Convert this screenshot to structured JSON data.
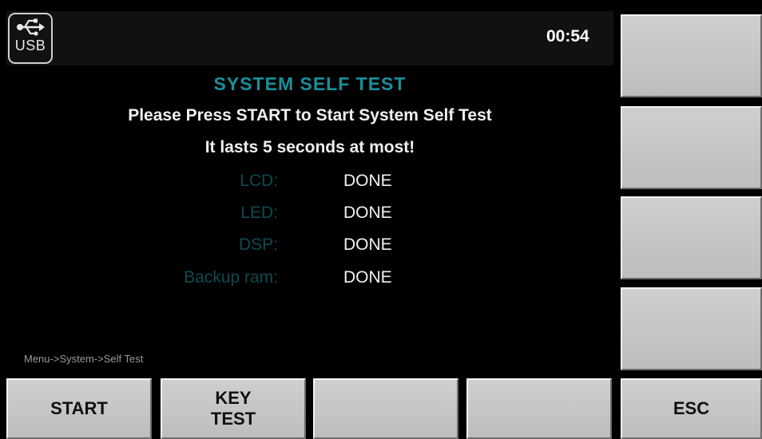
{
  "status": {
    "usb_label": "USB",
    "clock": "00:54"
  },
  "screen": {
    "title": "SYSTEM SELF TEST",
    "instruction_line1": "Please Press START to Start System Self Test",
    "instruction_line2": "It lasts 5 seconds at most!",
    "results": [
      {
        "label": "LCD:",
        "value": "DONE"
      },
      {
        "label": "LED:",
        "value": "DONE"
      },
      {
        "label": "DSP:",
        "value": "DONE"
      },
      {
        "label": "Backup ram:",
        "value": "DONE"
      }
    ],
    "breadcrumb": "Menu->System->Self Test"
  },
  "softkeys": {
    "bottom": [
      {
        "label": "START"
      },
      {
        "label_line1": "KEY",
        "label_line2": "TEST"
      },
      {
        "label": ""
      },
      {
        "label": ""
      },
      {
        "label": "ESC"
      }
    ],
    "side": [
      {
        "label": ""
      },
      {
        "label": ""
      },
      {
        "label": ""
      },
      {
        "label": ""
      }
    ]
  },
  "colors": {
    "title": "#1a8f9a",
    "label_dim": "#0e4a52",
    "background": "#000000",
    "button": "#c6c6c6"
  }
}
